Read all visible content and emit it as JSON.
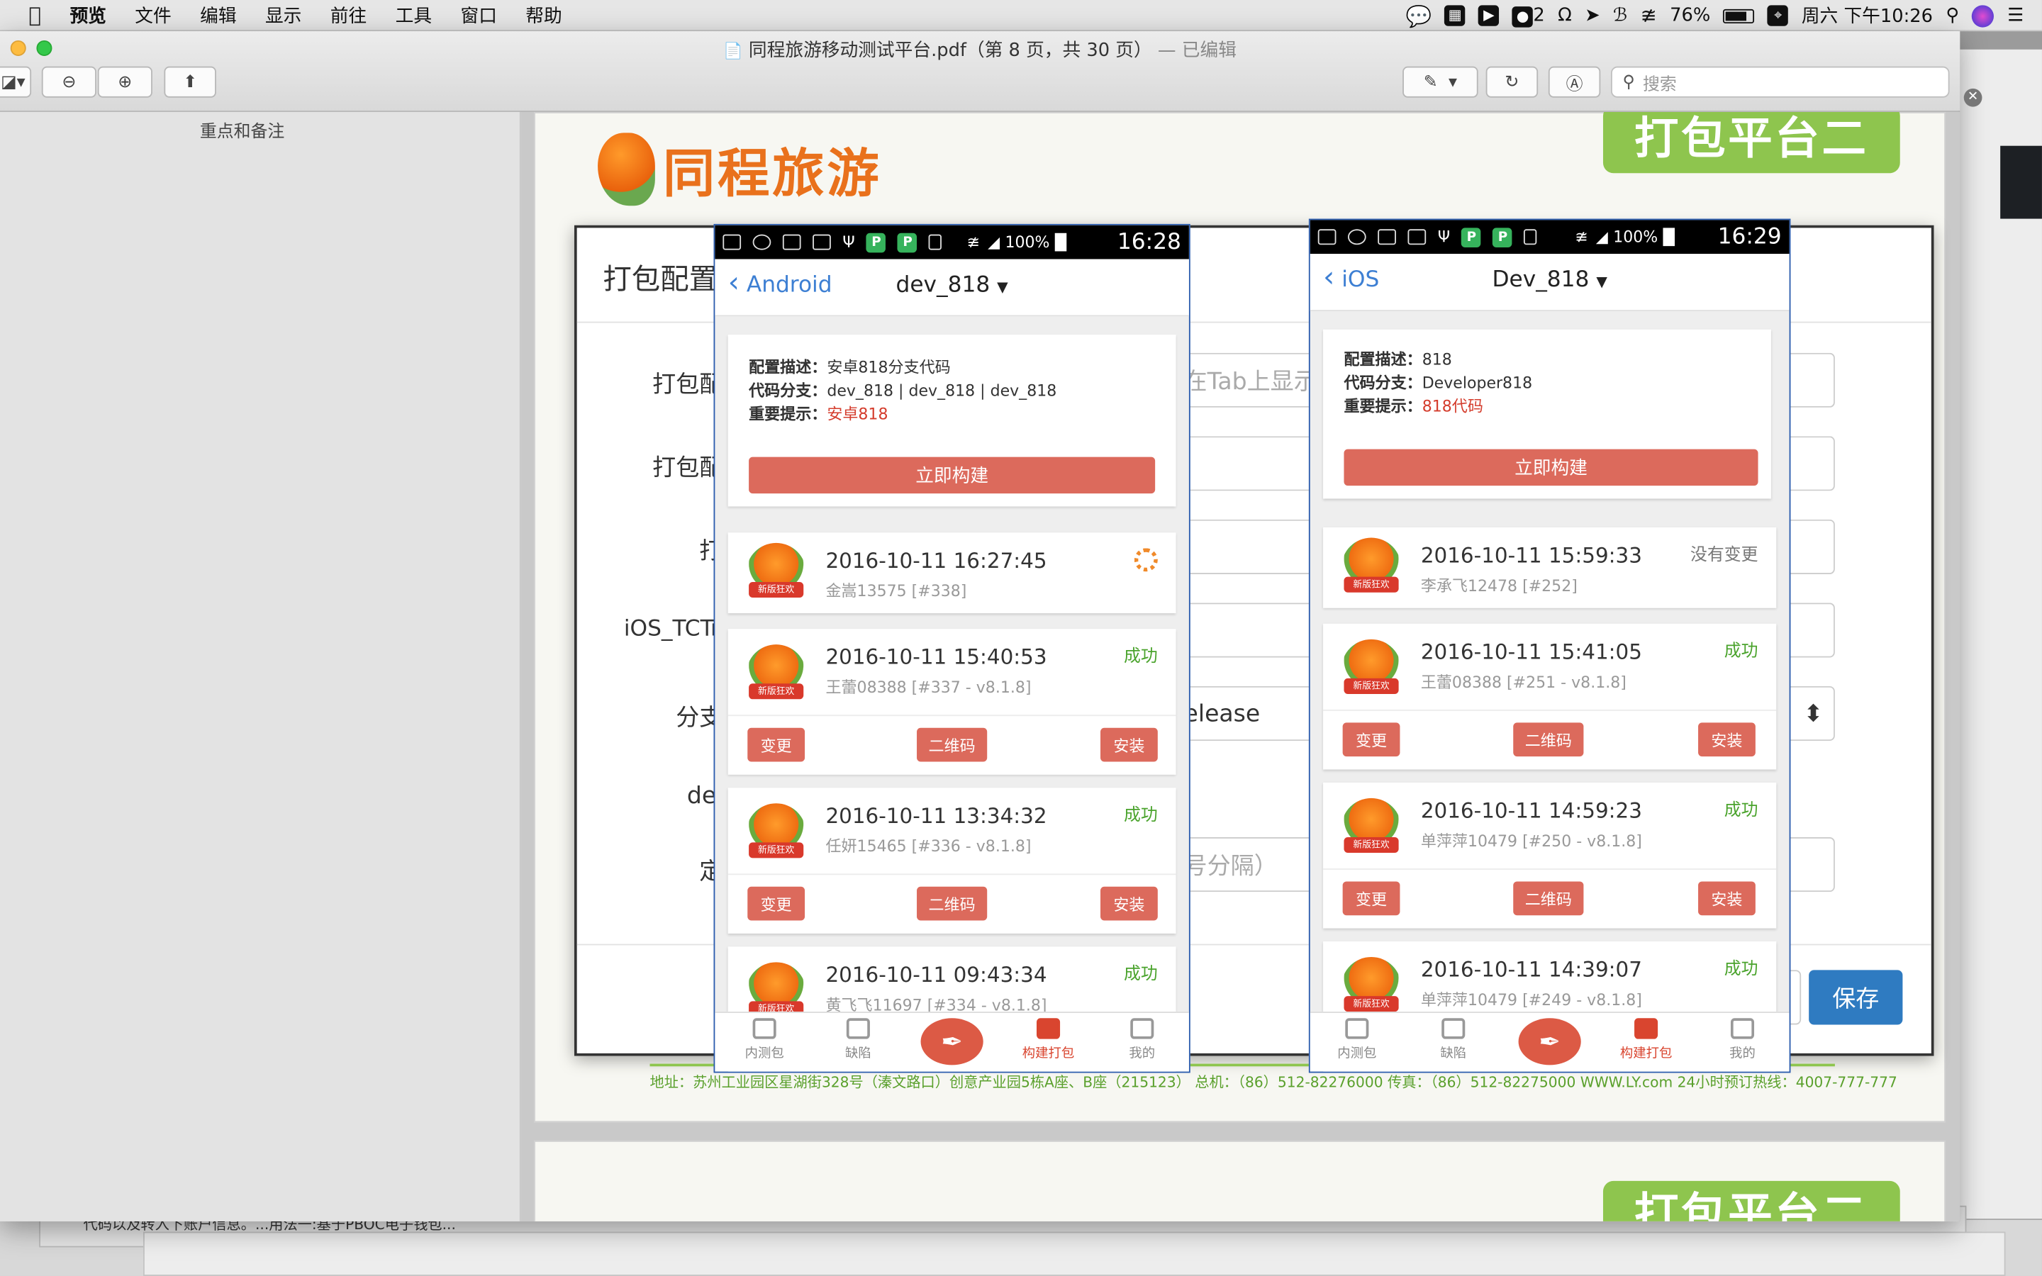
{
  "menubar": {
    "apple": "",
    "items": [
      "预览",
      "文件",
      "编辑",
      "显示",
      "前往",
      "工具",
      "窗口",
      "帮助"
    ],
    "status": {
      "badge_count": "2",
      "battery": "76%",
      "datetime": "周六 下午10:26"
    }
  },
  "window": {
    "title": "同程旅游移动测试平台.pdf（第 8 页，共 30 页）",
    "edited": "— 已编辑",
    "search_placeholder": "搜索",
    "sidebar_title": "重点和备注"
  },
  "page": {
    "logo_text": "同程旅游",
    "banner": "打包平台二",
    "banner2": "打包平台二",
    "footer": "地址：苏州工业园区星湖街328号（溱文路口）创意产业园5栋A座、B座（215123） 总机：（86）512-82276000  传真：（86）512-82275000  WWW.LY.com 24小时预订热线：4007-777-777",
    "bottom_text": "代码以及转入下账户信息。...用法一:基于PBOC电子钱包..."
  },
  "dialog": {
    "title": "打包配置",
    "labels": [
      "打包配",
      "打包配",
      "打",
      "iOS_TCTra",
      "分支",
      "del",
      "定"
    ],
    "field_fragments": {
      "tab_hint": "在Tab上显示",
      "release": "elease",
      "separator_hint": "号分隔）"
    },
    "save": "保存"
  },
  "android": {
    "status_time": "16:28",
    "battery": "100%",
    "back": "Android",
    "title": "dev_818",
    "desc_label": "配置描述：",
    "desc": "安卓818分支代码",
    "branch_label": "代码分支：",
    "branch": "dev_818 | dev_818 | dev_818",
    "note_label": "重要提示：",
    "note": "安卓818",
    "build": "立即构建",
    "records": [
      {
        "time": "2016-10-11 16:27:45",
        "user": "金嵩13575 [#338]",
        "status": ""
      },
      {
        "time": "2016-10-11 15:40:53",
        "user": "王蕾08388 [#337 - v8.1.8]",
        "status": "成功"
      },
      {
        "time": "2016-10-11 13:34:32",
        "user": "任妍15465 [#336 - v8.1.8]",
        "status": "成功"
      },
      {
        "time": "2016-10-11 09:43:34",
        "user": "黄飞飞11697 [#334 - v8.1.8]",
        "status": "成功"
      }
    ]
  },
  "ios": {
    "status_time": "16:29",
    "battery": "100%",
    "back": "iOS",
    "title": "Dev_818",
    "desc_label": "配置描述：",
    "desc": "818",
    "branch_label": "代码分支：",
    "branch": "Developer818",
    "note_label": "重要提示：",
    "note": "818代码",
    "build": "立即构建",
    "records": [
      {
        "time": "2016-10-11 15:59:33",
        "user": "李承飞12478 [#252]",
        "status": "没有变更"
      },
      {
        "time": "2016-10-11 15:41:05",
        "user": "王蕾08388 [#251 - v8.1.8]",
        "status": "成功"
      },
      {
        "time": "2016-10-11 14:59:23",
        "user": "单萍萍10479 [#250 - v8.1.8]",
        "status": "成功"
      },
      {
        "time": "2016-10-11 14:39:07",
        "user": "单萍萍10479 [#249 - v8.1.8]",
        "status": "成功"
      }
    ]
  },
  "actions": {
    "change": "变更",
    "qrcode": "二维码",
    "install": "安装"
  },
  "icon_badge": "新版狂欢",
  "tabs": [
    "内测包",
    "缺陷",
    "构建打包",
    "我的"
  ]
}
